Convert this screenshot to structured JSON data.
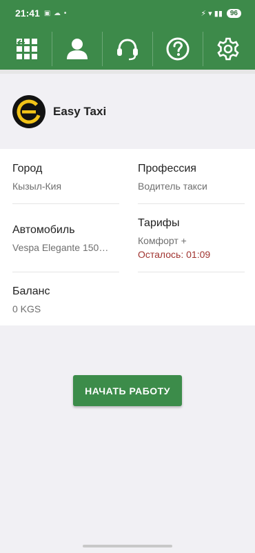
{
  "status": {
    "time": "21:41",
    "battery": "96"
  },
  "nav": {
    "items": [
      {
        "name": "menu",
        "icon": "grid-icon"
      },
      {
        "name": "profile",
        "icon": "person-icon"
      },
      {
        "name": "support",
        "icon": "headset-icon"
      },
      {
        "name": "help",
        "icon": "question-icon"
      },
      {
        "name": "settings",
        "icon": "gear-icon"
      }
    ]
  },
  "company": {
    "name": "Easy Taxi",
    "logo_letter": "e",
    "logo_color": "#f2c318"
  },
  "fields": {
    "city": {
      "label": "Город",
      "value": "Кызыл-Кия"
    },
    "profession": {
      "label": "Профессия",
      "value": "Водитель такси"
    },
    "car": {
      "label": "Автомобиль",
      "value": "Vespa Elegante 150…"
    },
    "tariffs": {
      "label": "Тарифы",
      "value": "Комфорт +",
      "remaining": "Осталось:  01:09"
    },
    "balance": {
      "label": "Баланс",
      "value": "0 KGS"
    }
  },
  "actions": {
    "start_label": "НАЧАТЬ РАБОТУ"
  },
  "colors": {
    "primary_green": "#3d8a4a",
    "remaining_red": "#a0332f"
  }
}
